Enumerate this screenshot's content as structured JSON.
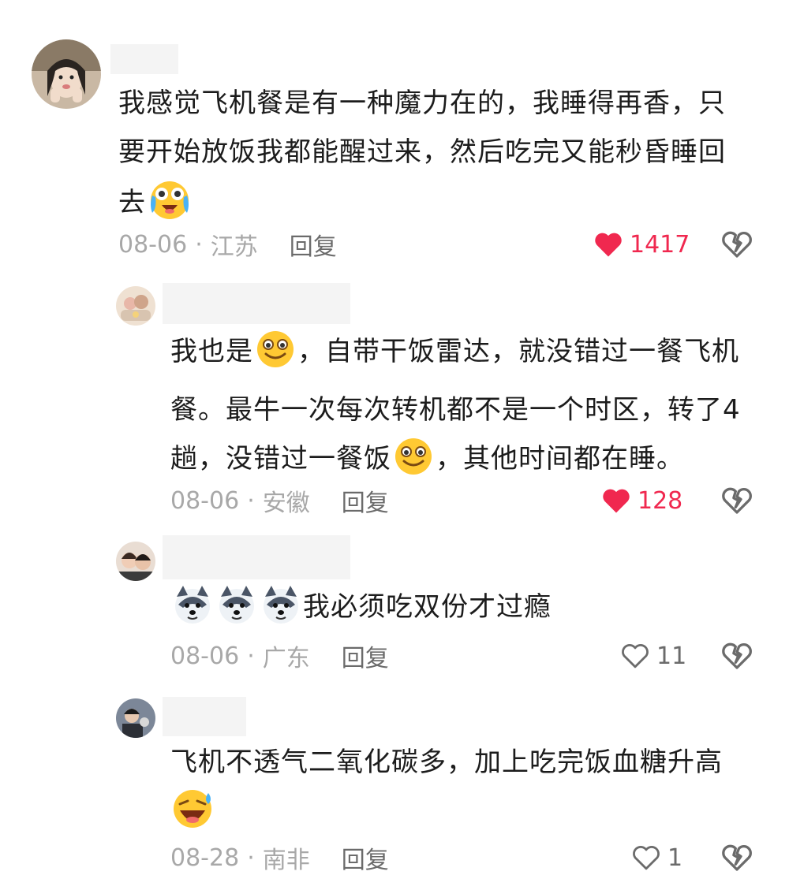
{
  "comments": [
    {
      "text": [
        "我感觉飞机餐是有一种魔力在的，我睡得再香，只",
        "要开始放饭我都能醒过来，然后吃完又能秒昏睡回",
        "去"
      ],
      "emoji": "crying-laughing-emoji",
      "date": "08-06",
      "separator": "·",
      "location": "江苏",
      "reply": "回复",
      "likes": "1417",
      "liked": true
    },
    {
      "text_a": "我也是",
      "emoji_a": "grin-emoji",
      "text_b": "，自带干饭雷达，就没错过一餐飞机",
      "line2": "餐。最牛一次每次转机都不是一个时区，转了4",
      "text_c": "趟，没错过一餐饭",
      "emoji_c": "grin-emoji",
      "text_d": "，其他时间都在睡。",
      "date": "08-06",
      "separator": "·",
      "location": "安徽",
      "reply": "回复",
      "likes": "128",
      "liked": true
    },
    {
      "emojis": [
        "husky-dog-emoji",
        "husky-dog-emoji",
        "husky-dog-emoji"
      ],
      "text": "我必须吃双份才过瘾",
      "date": "08-06",
      "separator": "·",
      "location": "广东",
      "reply": "回复",
      "likes": "11",
      "liked": false
    },
    {
      "text": "飞机不透气二氧化碳多，加上吃完饭血糖升高",
      "emoji": "sweat-laugh-emoji",
      "date": "08-28",
      "separator": "·",
      "location": "南非",
      "reply": "回复",
      "likes": "1",
      "liked": false
    }
  ],
  "colors": {
    "like_active": "#f0284f",
    "meta_text": "#a8a8a8",
    "reply_text": "#6b6b6b"
  }
}
